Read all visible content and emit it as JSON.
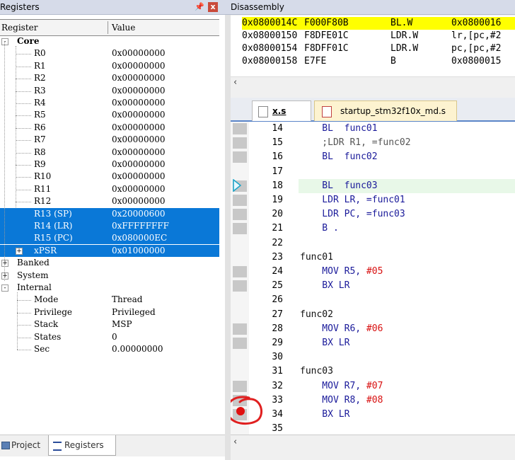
{
  "registers_panel": {
    "title": "Registers",
    "pin_glyph": "―",
    "close_glyph": "x",
    "col_register": "Register",
    "col_value": "Value",
    "core_label": "Core",
    "core_regs": [
      {
        "name": "R0",
        "value": "0x00000000"
      },
      {
        "name": "R1",
        "value": "0x00000000"
      },
      {
        "name": "R2",
        "value": "0x00000000"
      },
      {
        "name": "R3",
        "value": "0x00000000"
      },
      {
        "name": "R4",
        "value": "0x00000000"
      },
      {
        "name": "R5",
        "value": "0x00000000"
      },
      {
        "name": "R6",
        "value": "0x00000000"
      },
      {
        "name": "R7",
        "value": "0x00000000"
      },
      {
        "name": "R8",
        "value": "0x00000000"
      },
      {
        "name": "R9",
        "value": "0x00000000"
      },
      {
        "name": "R10",
        "value": "0x00000000"
      },
      {
        "name": "R11",
        "value": "0x00000000"
      },
      {
        "name": "R12",
        "value": "0x00000000"
      },
      {
        "name": "R13 (SP)",
        "value": "0x20000600"
      },
      {
        "name": "R14 (LR)",
        "value": "0xFFFFFFFF"
      },
      {
        "name": "R15 (PC)",
        "value": "0x080000EC"
      },
      {
        "name": "xPSR",
        "value": "0x01000000"
      }
    ],
    "banked_label": "Banked",
    "system_label": "System",
    "internal_label": "Internal",
    "internal_items": [
      {
        "name": "Mode",
        "value": "Thread"
      },
      {
        "name": "Privilege",
        "value": "Privileged"
      },
      {
        "name": "Stack",
        "value": "MSP"
      },
      {
        "name": "States",
        "value": "0"
      },
      {
        "name": "Sec",
        "value": "0.00000000"
      }
    ],
    "tabs": [
      {
        "label": "Project"
      },
      {
        "label": "Registers"
      }
    ]
  },
  "disassembly": {
    "title": "Disassembly",
    "rows": [
      {
        "addr": "0x0800014C",
        "code": "F000F80B",
        "mnem": "BL.W",
        "op": "0x0800016"
      },
      {
        "addr": "0x08000150",
        "code": "F8DFE01C",
        "mnem": "LDR.W",
        "op": "lr,[pc,#2"
      },
      {
        "addr": "0x08000154",
        "code": "F8DFF01C",
        "mnem": "LDR.W",
        "op": "pc,[pc,#2"
      },
      {
        "addr": "0x08000158",
        "code": "E7FE",
        "mnem": "B",
        "op": "0x0800015"
      }
    ]
  },
  "editor": {
    "tabs": [
      {
        "label": "x.s"
      },
      {
        "label": "startup_stm32f10x_md.s"
      }
    ],
    "lines": [
      {
        "n": "14",
        "text": "    BL  func01"
      },
      {
        "n": "15",
        "text": "    ;LDR R1, =func02"
      },
      {
        "n": "16",
        "text": "    BL  func02"
      },
      {
        "n": "17",
        "text": ""
      },
      {
        "n": "18",
        "text": "    BL  func03"
      },
      {
        "n": "19",
        "text": "    LDR LR, =func01"
      },
      {
        "n": "20",
        "text": "    LDR PC, =func03"
      },
      {
        "n": "21",
        "text": "    B ."
      },
      {
        "n": "22",
        "text": ""
      },
      {
        "n": "23",
        "text": "func01"
      },
      {
        "n": "24",
        "text": "    MOV R5, #05"
      },
      {
        "n": "25",
        "text": "    BX LR"
      },
      {
        "n": "26",
        "text": ""
      },
      {
        "n": "27",
        "text": "func02"
      },
      {
        "n": "28",
        "text": "    MOV R6, #06"
      },
      {
        "n": "29",
        "text": "    BX LR"
      },
      {
        "n": "30",
        "text": ""
      },
      {
        "n": "31",
        "text": "func03"
      },
      {
        "n": "32",
        "text": "    MOV R7, #07"
      },
      {
        "n": "33",
        "text": "    MOV R8, #08"
      },
      {
        "n": "34",
        "text": "    BX LR"
      },
      {
        "n": "35",
        "text": ""
      }
    ]
  },
  "colors": {
    "selection": "#0a78d7",
    "highlight_row": "#ffff00",
    "breakpoint": "#e01010",
    "annotation_circle": "#e02020",
    "immediate": "#d81010",
    "keyword": "#1a1a9a"
  }
}
